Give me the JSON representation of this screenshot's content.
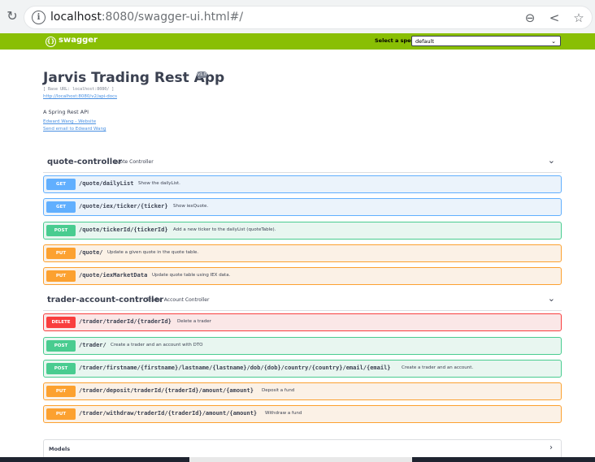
{
  "browser": {
    "url_host": "localhost",
    "url_rest": ":8080/swagger-ui.html#/"
  },
  "topbar": {
    "logo_text": "swagger",
    "spec_label": "Select a spec",
    "spec_value": "default"
  },
  "info": {
    "title": "Jarvis Trading Rest App",
    "version": "v1.0",
    "base_url": "[ Base URL: localhost:8080/ ]",
    "api_docs_link": "http://localhost:8080/v2/api-docs",
    "description": "A Spring Rest API",
    "contact_website": "Edward Wang - Website",
    "contact_email": "Send email to Edward Wang"
  },
  "controllers": [
    {
      "name": "quote-controller",
      "description": "Quote Controller",
      "operations": [
        {
          "method": "GET",
          "path": "/quote/dailyList",
          "summary": "Show the dailyList."
        },
        {
          "method": "GET",
          "path": "/quote/iex/ticker/{ticker}",
          "summary": "Show iexQuote."
        },
        {
          "method": "POST",
          "path": "/quote/tickerId/{tickerId}",
          "summary": "Add a new ticker to the dailyList (quoteTable)."
        },
        {
          "method": "PUT",
          "path": "/quote/",
          "summary": "Update a given quote in the quote table."
        },
        {
          "method": "PUT",
          "path": "/quote/iexMarketData",
          "summary": "Update quote table using IEX data."
        }
      ]
    },
    {
      "name": "trader-account-controller",
      "description": "Trader Account Controller",
      "operations": [
        {
          "method": "DELETE",
          "path": "/trader/traderId/{traderId}",
          "summary": "Delete a trader"
        },
        {
          "method": "POST",
          "path": "/trader/",
          "summary": "Create a trader and an account with DTO"
        },
        {
          "method": "POST",
          "path": "/trader/firstname/{firstname}/lastname/{lastname}/dob/{dob}/country/{country}/email/{email}",
          "summary": "Create a trader and an account."
        },
        {
          "method": "PUT",
          "path": "/trader/deposit/traderId/{traderId}/amount/{amount}",
          "summary": "Deposit a fund"
        },
        {
          "method": "PUT",
          "path": "/trader/withdraw/traderId/{traderId}/amount/{amount}",
          "summary": "Withdraw a fund"
        }
      ]
    }
  ],
  "models": {
    "title": "Models"
  },
  "icons": {
    "reload": "reload-icon",
    "info": "info-icon",
    "zoom": "zoom-icon",
    "share": "share-icon",
    "star": "star-icon",
    "chevron": "chevron-down-icon"
  },
  "colors": {
    "topbar": "#89bf04",
    "get": "#61affe",
    "post": "#49cc90",
    "put": "#fca130",
    "delete": "#f93e3e"
  }
}
